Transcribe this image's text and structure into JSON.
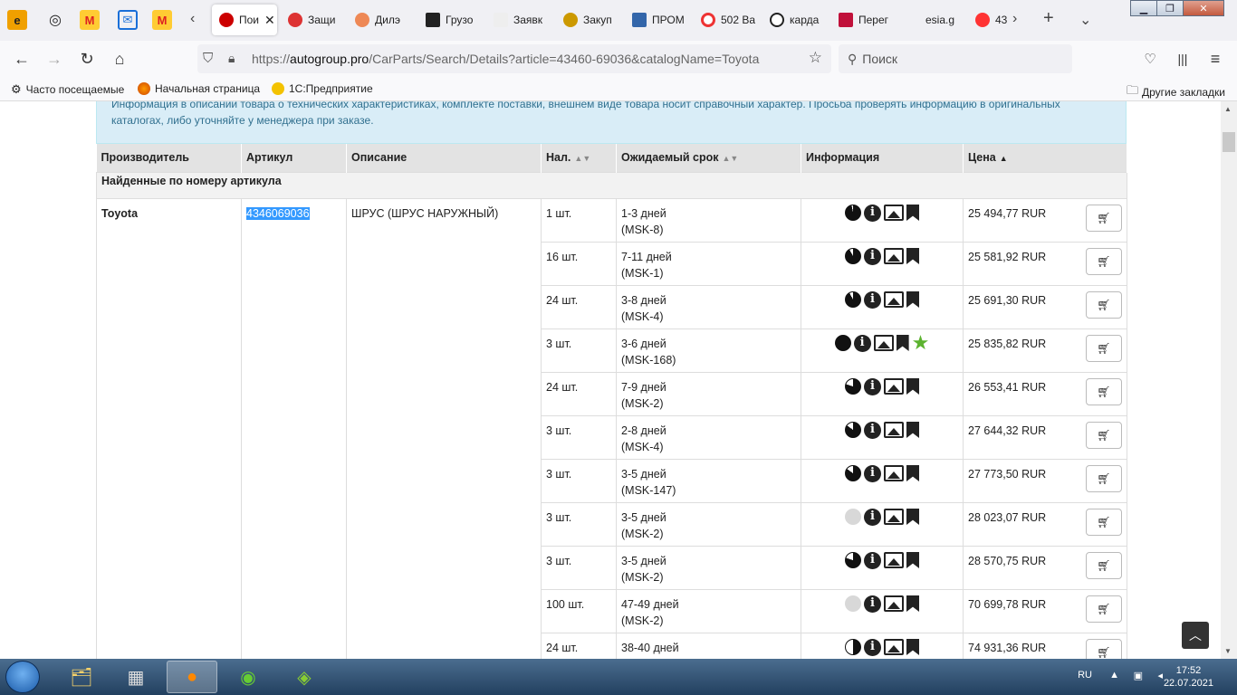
{
  "tabs": [
    {
      "label": "Пои",
      "active": true
    },
    {
      "label": "Защи"
    },
    {
      "label": "Дилэ"
    },
    {
      "label": "Грузо"
    },
    {
      "label": "Заявк"
    },
    {
      "label": "Закуп"
    },
    {
      "label": "ПРОМ"
    },
    {
      "label": "502 Ва"
    },
    {
      "label": "карда"
    },
    {
      "label": "Перег"
    },
    {
      "label": "esia.g"
    },
    {
      "label": "43"
    }
  ],
  "nav": {
    "url_prefix": "https://",
    "url_host": "autogroup.pro",
    "url_path": "/CarParts/Search/Details?article=43460-69036&catalogName=Toyota",
    "search_placeholder": "Поиск"
  },
  "bookmarks": {
    "items": [
      "Часто посещаемые",
      "Начальная страница",
      "1С:Предприятие"
    ],
    "other": "Другие закладки"
  },
  "notice": "Информация в описании товара о технических характеристиках, комплекте поставки, внешнем виде товара носит справочный характер. Просьба проверять информацию в оригинальных каталогах, либо уточняйте у менеджера при заказе.",
  "table": {
    "headers": {
      "manufacturer": "Производитель",
      "article": "Артикул",
      "description": "Описание",
      "stock": "Нал.",
      "term": "Ожидаемый срок",
      "info": "Информация",
      "price": "Цена"
    },
    "group_title": "Найденные по номеру артикула",
    "brand": "Toyota",
    "article": "4346069036",
    "description": "ШРУС (ШРУС НАРУЖНЫЙ)",
    "rows": [
      {
        "stock": "1 шт.",
        "term": "1-3 дней",
        "warehouse": "(MSK-8)",
        "price": "25 494,77 RUR",
        "pie": 0.97,
        "star": false
      },
      {
        "stock": "16 шт.",
        "term": "7-11 дней",
        "warehouse": "(MSK-1)",
        "price": "25 581,92 RUR",
        "pie": 0.92,
        "star": false
      },
      {
        "stock": "24 шт.",
        "term": "3-8 дней",
        "warehouse": "(MSK-4)",
        "price": "25 691,30 RUR",
        "pie": 0.92,
        "star": false
      },
      {
        "stock": "3 шт.",
        "term": "3-6 дней",
        "warehouse": "(MSK-168)",
        "price": "25 835,82 RUR",
        "pie": 1.0,
        "star": true
      },
      {
        "stock": "24 шт.",
        "term": "7-9 дней",
        "warehouse": "(MSK-2)",
        "price": "26 553,41 RUR",
        "pie": 0.8,
        "star": false
      },
      {
        "stock": "3 шт.",
        "term": "2-8 дней",
        "warehouse": "(MSK-4)",
        "price": "27 644,32 RUR",
        "pie": 0.85,
        "star": false
      },
      {
        "stock": "3 шт.",
        "term": "3-5 дней",
        "warehouse": "(MSK-147)",
        "price": "27 773,50 RUR",
        "pie": 0.85,
        "star": false
      },
      {
        "stock": "3 шт.",
        "term": "3-5 дней",
        "warehouse": "(MSK-2)",
        "price": "28 023,07 RUR",
        "pie": 0.0,
        "star": false
      },
      {
        "stock": "3 шт.",
        "term": "3-5 дней",
        "warehouse": "(MSK-2)",
        "price": "28 570,75 RUR",
        "pie": 0.8,
        "star": false
      },
      {
        "stock": "100 шт.",
        "term": "47-49 дней",
        "warehouse": "(MSK-2)",
        "price": "70 699,78 RUR",
        "pie": 0.0,
        "star": false
      },
      {
        "stock": "24 шт.",
        "term": "38-40 дней",
        "warehouse": "",
        "price": "74 931,36 RUR",
        "pie": 0.5,
        "star": false
      }
    ]
  },
  "taskbar": {
    "lang": "RU",
    "time": "17:52",
    "date": "22.07.2021"
  },
  "colors": {
    "notice_bg": "#d9edf7",
    "header_bg": "#e3e3e3",
    "selection": "#3399ff",
    "star": "#5cb32f"
  }
}
